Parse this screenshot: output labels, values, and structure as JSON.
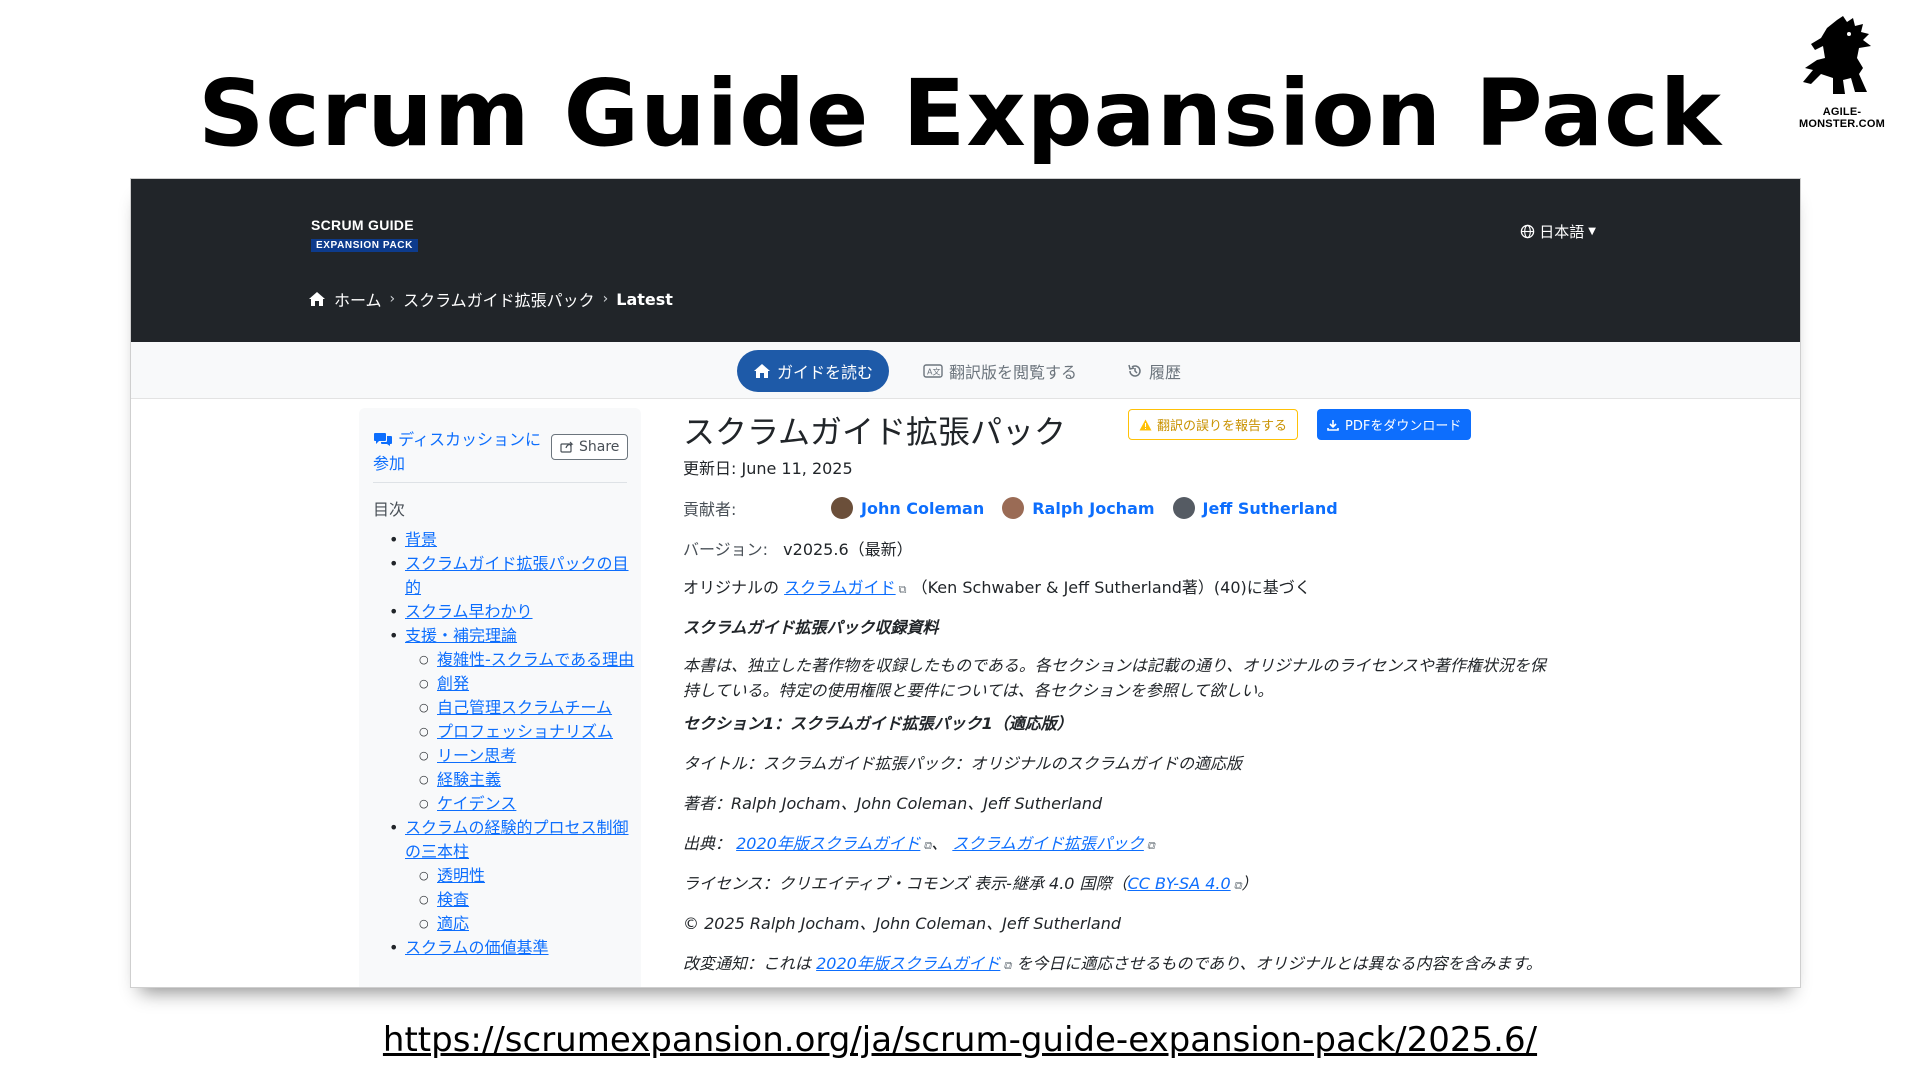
{
  "slide": {
    "title": "Scrum Guide Expansion Pack",
    "logo_text": "AGILE-MONSTER.COM",
    "url": "https://scrumexpansion.org/ja/scrum-guide-expansion-pack/2025.6/"
  },
  "header": {
    "brand_line1": "SCRUM GUIDE",
    "brand_line2": "EXPANSION PACK",
    "language": "日本語",
    "breadcrumb": [
      "ホーム",
      "スクラムガイド拡張パック",
      "Latest"
    ]
  },
  "tabs": [
    {
      "label": "ガイドを読む",
      "icon": "home-icon"
    },
    {
      "label": "翻訳版を閲覧する",
      "icon": "translate-icon"
    },
    {
      "label": "履歴",
      "icon": "history-icon"
    }
  ],
  "sidebar": {
    "discussion": "ディスカッションに参加",
    "share": "Share",
    "toc_title": "目次",
    "toc": [
      {
        "level": 1,
        "label": "背景"
      },
      {
        "level": 1,
        "label": "スクラムガイド拡張パックの目的"
      },
      {
        "level": 1,
        "label": "スクラム早わかり"
      },
      {
        "level": 1,
        "label": "支援・補完理論"
      },
      {
        "level": 2,
        "label": "複雑性-スクラムである理由"
      },
      {
        "level": 2,
        "label": "創発"
      },
      {
        "level": 2,
        "label": "自己管理スクラムチーム"
      },
      {
        "level": 2,
        "label": "プロフェッショナリズム"
      },
      {
        "level": 2,
        "label": "リーン思考"
      },
      {
        "level": 2,
        "label": "経験主義"
      },
      {
        "level": 2,
        "label": "ケイデンス"
      },
      {
        "level": 1,
        "label": "スクラムの経験的プロセス制御の三本柱"
      },
      {
        "level": 2,
        "label": "透明性"
      },
      {
        "level": 2,
        "label": "検査"
      },
      {
        "level": 2,
        "label": "適応"
      },
      {
        "level": 1,
        "label": "スクラムの価値基準"
      }
    ]
  },
  "main": {
    "title": "スクラムガイド拡張パック",
    "report_button": "翻訳の誤りを報告する",
    "pdf_button": "PDFをダウンロード",
    "updated": "更新日: June 11, 2025",
    "contributors_label": "貢献者:",
    "contributors": [
      {
        "name": "John Coleman",
        "color": "#6b4f3a"
      },
      {
        "name": "Ralph Jocham",
        "color": "#9a6b55"
      },
      {
        "name": "Jeff Sutherland",
        "color": "#555b63"
      }
    ],
    "version_label": "バージョン:",
    "version_value": "v2025.6（最新）",
    "original_prefix": "オリジナルの",
    "original_link": "スクラムガイド",
    "original_suffix": "（Ken Schwaber & Jeff Sutherland著）(40)に基づく",
    "collection_heading": "スクラムガイド拡張パック収録資料",
    "collection_body": "本書は、独立した著作物を収録したものである。各セクションは記載の通り、オリジナルのライセンスや著作権状況を保持している。特定の使用権限と要件については、各セクションを参照して欲しい。",
    "section1_heading": "セクション1：スクラムガイド拡張パック1（適応版）",
    "title_line": "タイトル：スクラムガイド拡張パック：オリジナルのスクラムガイドの適応版",
    "authors_line": "著者：Ralph Jocham、John Coleman、Jeff Sutherland",
    "source_prefix": "出典：",
    "source_link1": "2020年版スクラムガイド",
    "source_sep": "、",
    "source_link2": "スクラムガイド拡張パック",
    "license_prefix": "ライセンス：クリエイティブ・コモンズ 表示-継承 4.0 国際（",
    "license_link": "CC BY-SA 4.0",
    "license_suffix": "）",
    "copyright": "© 2025 Ralph Jocham、John Coleman、Jeff Sutherland",
    "notice_prefix": "改変通知：これは",
    "notice_link": "2020年版スクラムガイド",
    "notice_suffix": "を今日に適応させるものであり、オリジナルとは異なる内容を含みます。"
  }
}
